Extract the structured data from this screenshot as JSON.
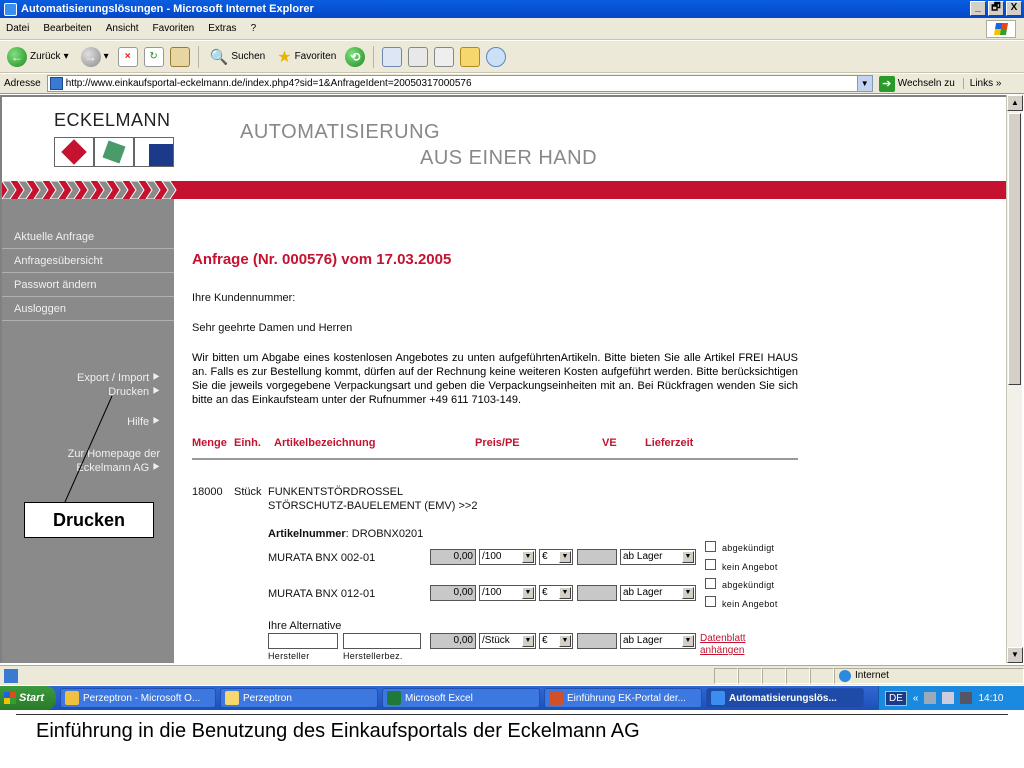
{
  "window": {
    "title": "Automatisierungslösungen - Microsoft Internet Explorer",
    "controls": [
      "_",
      "🗗",
      "X"
    ]
  },
  "menu": [
    "Datei",
    "Bearbeiten",
    "Ansicht",
    "Favoriten",
    "Extras",
    "?"
  ],
  "toolbar": {
    "back_label": "Zurück",
    "search_label": "Suchen",
    "favorites_label": "Favoriten"
  },
  "addressbar": {
    "label": "Adresse",
    "url": "http://www.einkaufsportal-eckelmann.de/index.php4?sid=1&AnfrageIdent=20050317000576",
    "go_label": "Wechseln zu",
    "links_label": "Links",
    "links_more": "»"
  },
  "site": {
    "logo_text": "ECKELMANN",
    "tagline_line1": "AUTOMATISIERUNG",
    "tagline_line2": "AUS EINER HAND",
    "brand_red": "#c41230"
  },
  "sidebar": {
    "items": [
      "Aktuelle Anfrage",
      "Anfragesübersicht",
      "Passwort ändern",
      "Ausloggen"
    ],
    "export_import": "Export / Import",
    "drucken": "Drucken",
    "hilfe": "Hilfe",
    "homepage_line1": "Zur Homepage der",
    "homepage_line2": "Eckelmann AG",
    "arrow": "⯈"
  },
  "main": {
    "title": "Anfrage (Nr. 000576) vom 17.03.2005",
    "customer_label": "Ihre Kundennummer:",
    "salutation": "Sehr geehrte Damen und Herren",
    "paragraph": "Wir bitten um Abgabe eines kostenlosen Angebotes zu unten aufgeführtenArtikeln. Bitte bieten Sie alle Artikel FREI HAUS an. Falls es zur Bestellung kommt, dürfen auf der Rechnung keine weiteren Kosten aufgeführt werden. Bitte berücksichtigen Sie die jeweils vorgegebene Verpackungsart und geben die Verpackungseinheiten mit an. Bei Rückfragen wenden Sie sich bitte an das Einkaufsteam unter der Rufnummer +49 611 7103-149.",
    "columns": {
      "menge": "Menge",
      "einh": "Einh.",
      "artikel": "Artikelbezeichnung",
      "preis": "Preis/PE",
      "ve": "VE",
      "lieferzeit": "Lieferzeit"
    },
    "item": {
      "qty": "18000",
      "unit": "Stück",
      "name_line1": "FUNKENTSTÖRDROSSEL",
      "name_line2": "STÖRSCHUTZ-BAUELEMENT (EMV) >>2",
      "artnr_label": "Artikelnummer",
      "artnr_value": ": DROBNX0201"
    },
    "offers": [
      {
        "name": "MURATA BNX 002-01",
        "price": "0,00",
        "pe": "/100",
        "currency": "€",
        "ve": "",
        "delivery": "ab Lager",
        "cb1": "abgekündigt",
        "cb2": "kein Angebot"
      },
      {
        "name": "MURATA BNX 012-01",
        "price": "0,00",
        "pe": "/100",
        "currency": "€",
        "ve": "",
        "delivery": "ab Lager",
        "cb1": "abgekündigt",
        "cb2": "kein Angebot"
      }
    ],
    "alternative": {
      "label": "Ihre Alternative",
      "price": "0,00",
      "pe": "/Stück",
      "currency": "€",
      "delivery": "ab Lager",
      "link_line1": "Datenblatt",
      "link_line2": "anhängen",
      "hersteller": "Hersteller",
      "herstellerbez": "Herstellerbez."
    }
  },
  "callout": "Drucken",
  "status": {
    "zone": "Internet"
  },
  "taskbar": {
    "start": "Start",
    "tasks": [
      "Perzeptron - Microsoft O...",
      "Perzeptron",
      "Microsoft Excel",
      "Einführung EK-Portal der...",
      "Automatisierungslös..."
    ],
    "lang": "DE",
    "more": "«",
    "clock": "14:10"
  },
  "caption": "Einführung in die Benutzung des Einkaufsportals der Eckelmann AG"
}
